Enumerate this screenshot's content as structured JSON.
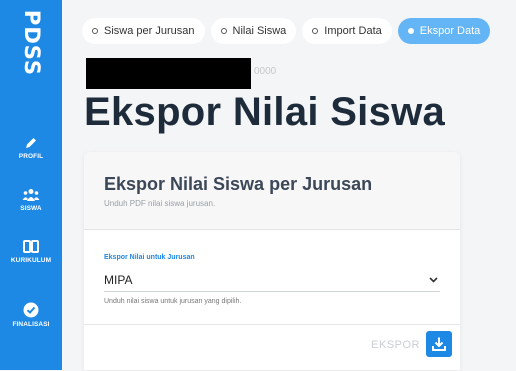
{
  "sidebar": {
    "brand": "PDSS",
    "items": [
      {
        "label": "PROFIL",
        "icon": "pencil-icon"
      },
      {
        "label": "SISWA",
        "icon": "users-icon"
      },
      {
        "label": "KURIKULUM",
        "icon": "book-icon"
      },
      {
        "label": "FINALISASI",
        "icon": "check-circle-icon"
      }
    ]
  },
  "tabs": [
    {
      "label": "Siswa per Jurusan",
      "active": false
    },
    {
      "label": "Nilai Siswa",
      "active": false
    },
    {
      "label": "Import Data",
      "active": false
    },
    {
      "label": "Ekspor Data",
      "active": true
    }
  ],
  "header": {
    "redacted_tail": "0000",
    "title": "Ekspor Nilai Siswa"
  },
  "card": {
    "title": "Ekspor Nilai Siswa per Jurusan",
    "subtitle": "Unduh PDF nilai siswa jurusan.",
    "field_label": "Ekspor Nilai untuk Jurusan",
    "selected": "MIPA",
    "help": "Unduh nilai siswa untuk jurusan yang dipilih.",
    "export_label": "EKSPOR"
  },
  "colors": {
    "sidebar": "#1e88e5",
    "active_tab": "#64b5f6",
    "title": "#1d2b3a"
  }
}
